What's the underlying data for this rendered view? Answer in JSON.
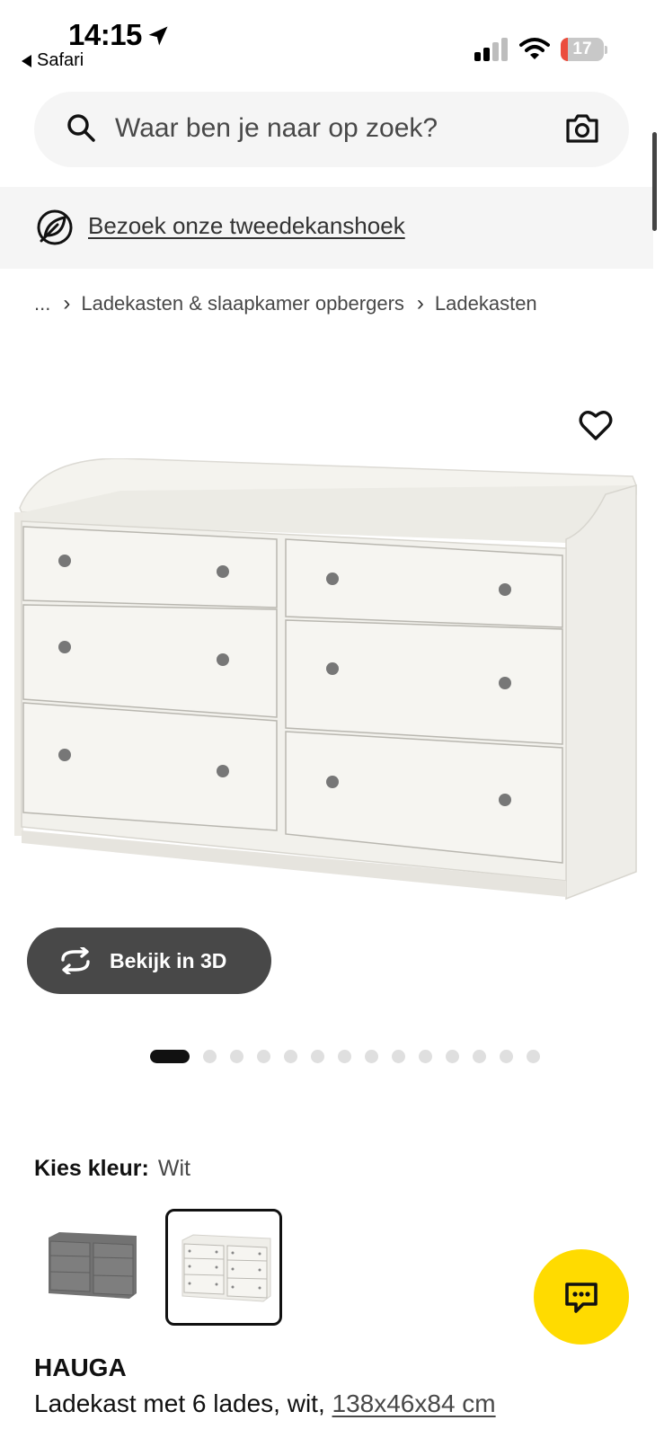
{
  "status_bar": {
    "time": "14:15",
    "back_app": "Safari",
    "battery_level": "17",
    "battery_color": "#eb4d3d"
  },
  "search": {
    "placeholder": "Waar ben je naar op zoek?",
    "icon": "search-icon",
    "camera_icon": "camera-icon"
  },
  "banner": {
    "icon": "leaf-icon",
    "link_text": "Bezoek onze tweedekanshoek"
  },
  "breadcrumb": {
    "items": [
      "...",
      "Ladekasten & slaapkamer opbergers",
      "Ladekasten"
    ]
  },
  "gallery": {
    "favorite_icon": "heart-icon",
    "view_3d_label": "Bekijk in 3D",
    "view_3d_icon": "rotate-3d-icon",
    "image_count": 14,
    "active_index": 0
  },
  "color_picker": {
    "label": "Kies kleur:",
    "selected": "Wit",
    "options": [
      "grijs",
      "wit"
    ]
  },
  "chat": {
    "icon": "chat-icon",
    "color": "#ffdb00"
  },
  "product": {
    "name": "HAUGA",
    "description": "Ladekast met 6 lades, wit,",
    "dimensions": "138x46x84 cm"
  },
  "colors": {
    "accent_dark": "#484848",
    "surface": "#f5f5f5"
  }
}
